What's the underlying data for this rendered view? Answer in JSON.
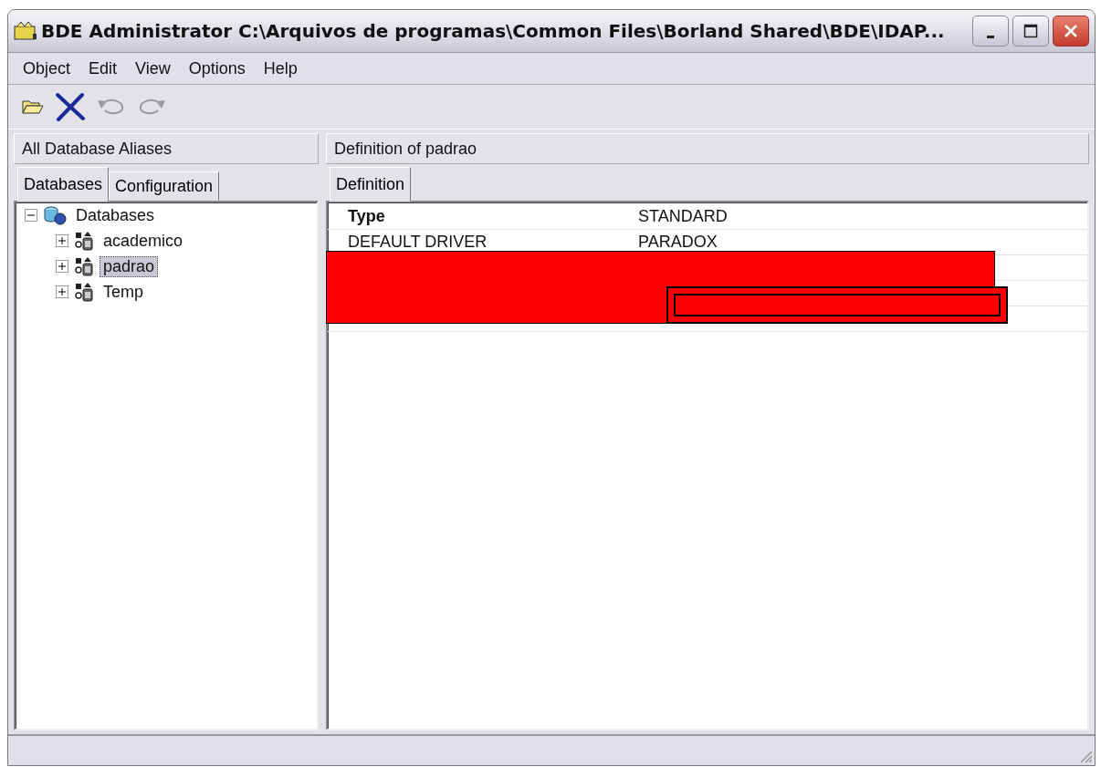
{
  "window": {
    "title": "BDE Administrator  C:\\Arquivos de programas\\Common Files\\Borland Shared\\BDE\\IDAP..."
  },
  "menu": [
    "Object",
    "Edit",
    "View",
    "Options",
    "Help"
  ],
  "toolbar": [
    {
      "kind": "open",
      "disabled": false
    },
    {
      "kind": "delete",
      "disabled": false
    },
    {
      "kind": "undo",
      "disabled": true
    },
    {
      "kind": "redo",
      "disabled": true
    }
  ],
  "left_pane": {
    "header": "All Database Aliases",
    "tabs": [
      {
        "label": "Databases",
        "selected": true
      },
      {
        "label": "Configuration",
        "selected": false
      }
    ],
    "tree": {
      "label": "Databases",
      "expanded": true,
      "selected": false,
      "children": [
        {
          "label": "academico",
          "expanded": false,
          "selected": false
        },
        {
          "label": "padrao",
          "expanded": false,
          "selected": true
        },
        {
          "label": "Temp",
          "expanded": false,
          "selected": false
        }
      ]
    }
  },
  "right_pane": {
    "header": "Definition of padrao",
    "tabs": [
      {
        "label": "Definition",
        "selected": true
      }
    ],
    "properties": [
      {
        "name": "Type",
        "value": "STANDARD",
        "bold": true
      },
      {
        "name": "DEFAULT DRIVER",
        "value": "PARADOX",
        "bold": false
      }
    ]
  }
}
